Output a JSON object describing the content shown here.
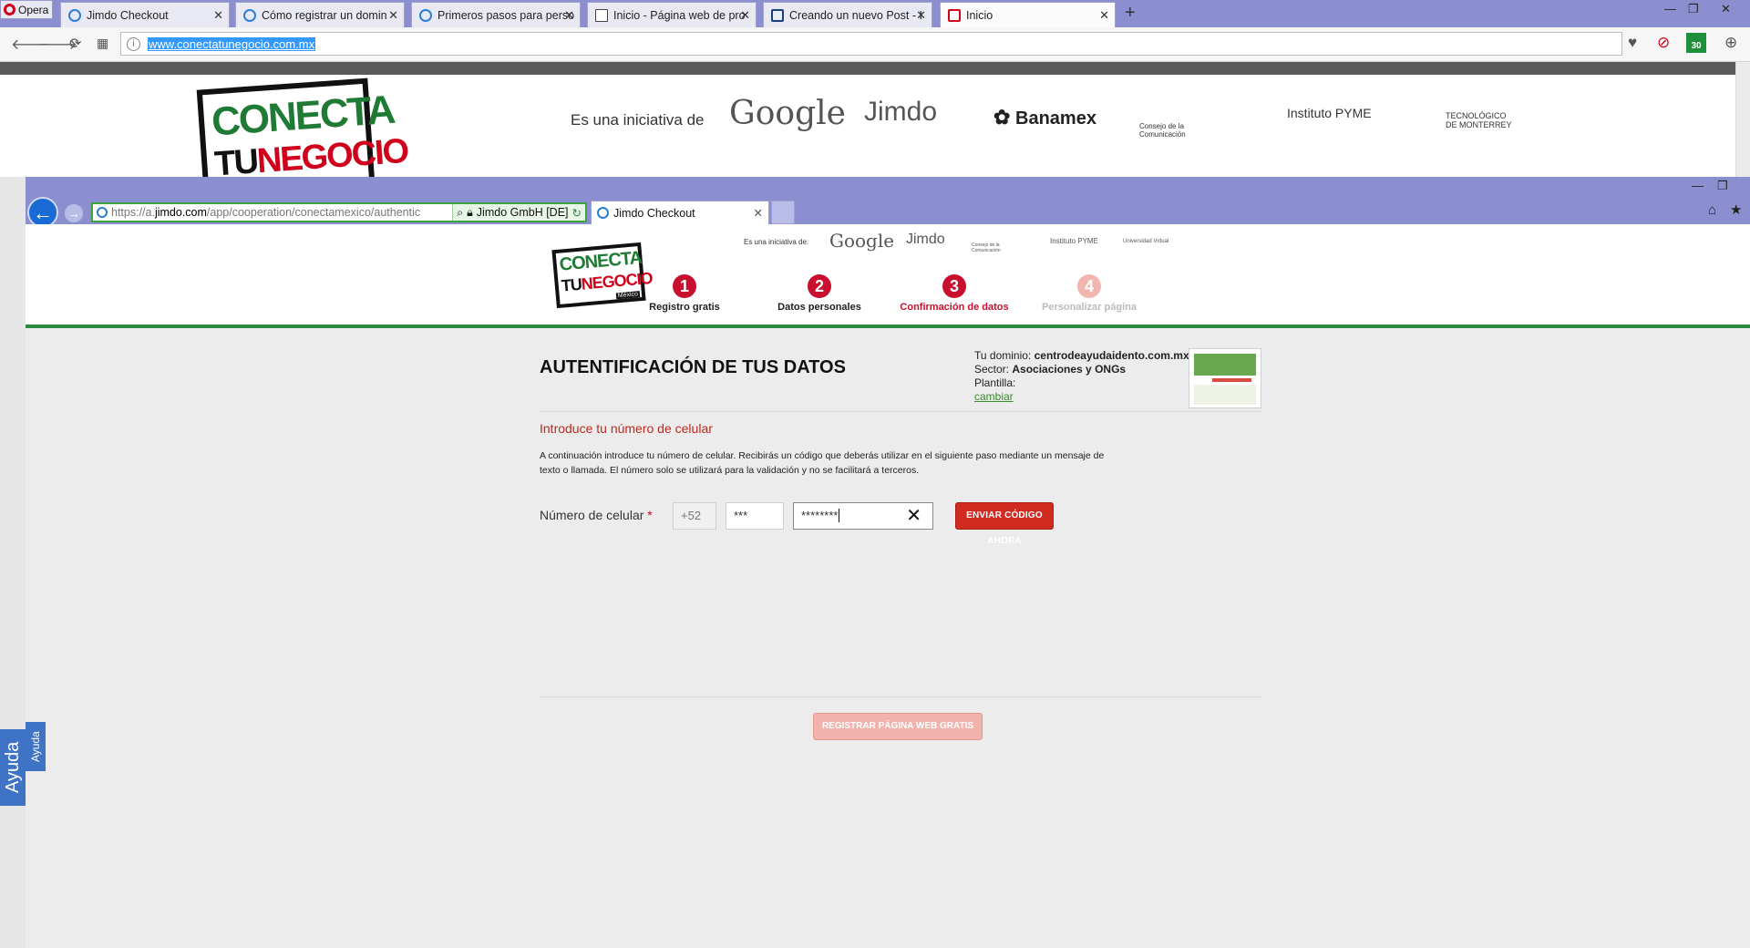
{
  "outer": {
    "menu_label": "Opera",
    "tabs": [
      {
        "title": "Jimdo Checkout"
      },
      {
        "title": "Cómo registrar un domin"
      },
      {
        "title": "Primeros pasos para perso"
      },
      {
        "title": "Inicio - Página web de pro"
      },
      {
        "title": "Creando un nuevo Post - I"
      },
      {
        "title": "Inicio"
      }
    ],
    "new_tab": "+",
    "close_glyph": "✕",
    "url": "www.conectatunegocio.com.mx",
    "badge": "30"
  },
  "cp_header": {
    "logo_line1": "CONECTA",
    "logo_tu": "TU",
    "logo_negocio": "NEGOCIO",
    "initiative": "Es una iniciativa de",
    "partners": [
      "Google",
      "Jimdo",
      "Banamex",
      "Consejo de la Comunicación",
      "Instituto PYME",
      "TECNOLÓGICO DE MONTERREY"
    ]
  },
  "inner_browser": {
    "url_scheme": "https://a.",
    "url_domain": "jimdo.com",
    "url_path": "/app/cooperation/conectamexico/authentic",
    "cert": "Jimdo GmbH [DE]",
    "tab_title": "Jimdo Checkout"
  },
  "jimdo": {
    "logo_a": "CONECTA",
    "logo_tu": "TU",
    "logo_negocio": "NEGOCIO",
    "logo_country": "México",
    "initiative": "Es una iniciativa de:",
    "partners": [
      "Google",
      "Jimdo",
      "Consejo de la Comunicación",
      "Instituto PYME",
      "Universidad Virtual"
    ],
    "steps": [
      {
        "num": "1",
        "label": "Registro gratis",
        "color": "#c8102e",
        "label_color": "#222"
      },
      {
        "num": "2",
        "label": "Datos personales",
        "color": "#c8102e",
        "label_color": "#222"
      },
      {
        "num": "3",
        "label": "Confirmación de datos",
        "color": "#c8102e",
        "label_color": "#c8102e"
      },
      {
        "num": "4",
        "label": "Personalizar página",
        "color": "#f2b6b0",
        "label_color": "#bbbbbb"
      }
    ],
    "title": "AUTENTIFICACIÓN DE TUS DATOS",
    "domain_label": "Tu dominio:",
    "domain_value": "centrodeayudaidento.com.mx",
    "sector_label": "Sector:",
    "sector_value": "Asociaciones y ONGs",
    "template_label": "Plantilla:",
    "change_link": "cambiar",
    "intro_heading": "Introduce tu número de celular",
    "intro_text": "A continuación introduce tu número de celular. Recibirás un código que deberás utilizar en el siguiente paso mediante un mensaje de texto o llamada. El número solo se utilizará para la validación y no se facilitará a terceros.",
    "phone_label": "Número de celular",
    "required_mark": "*",
    "country_code": "+52",
    "area_code": "***",
    "phone_number": "********",
    "clear_glyph": "✕",
    "send_button": "ENVIAR CÓDIGO AHORA",
    "register_button": "REGISTRAR PÁGINA WEB GRATIS"
  },
  "help_tab": "Ayuda",
  "help_tab_small": "Ayuda"
}
